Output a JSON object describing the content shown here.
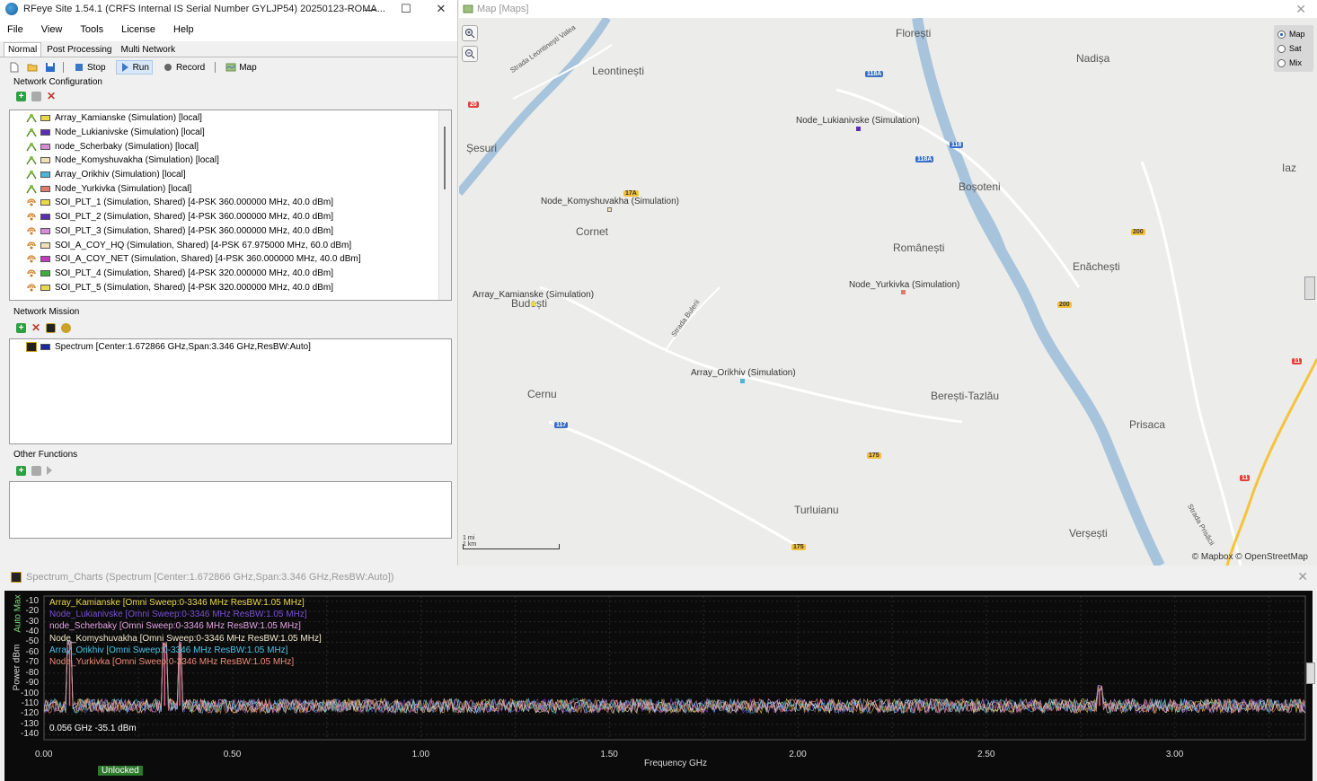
{
  "app": {
    "title": "RFeye Site 1.54.1 (CRFS Internal IS Serial Number GYLJP54) 20250123-ROMA...",
    "window_controls": {
      "minimize": "—",
      "maximize": "☐",
      "close": "✕"
    },
    "menu": [
      "File",
      "View",
      "Tools",
      "License",
      "Help"
    ],
    "tabs": [
      "Normal",
      "Post Processing",
      "Multi Network"
    ],
    "active_tab": "Normal",
    "toolbar": {
      "stop": "Stop",
      "run": "Run",
      "record": "Record",
      "map": "Map"
    }
  },
  "network_configuration": {
    "label": "Network Configuration",
    "items": [
      {
        "label": "Array_Kamianske (Simulation) [local]",
        "color": "#e9d84a",
        "kind": "node"
      },
      {
        "label": "Node_Lukianivske (Simulation) [local]",
        "color": "#5b2fb3",
        "kind": "node"
      },
      {
        "label": "node_Scherbaky (Simulation) [local]",
        "color": "#d48bd8",
        "kind": "node"
      },
      {
        "label": "Node_Komyshuvakha (Simulation) [local]",
        "color": "#f1dfb5",
        "kind": "node"
      },
      {
        "label": "Array_Orikhiv (Simulation) [local]",
        "color": "#4bb4d8",
        "kind": "node"
      },
      {
        "label": "Node_Yurkivka (Simulation) [local]",
        "color": "#e07a6a",
        "kind": "node"
      },
      {
        "label": "SOI_PLT_1 (Simulation, Shared) [4-PSK 360.000000 MHz, 40.0 dBm]",
        "color": "#e9d84a",
        "kind": "soi"
      },
      {
        "label": "SOI_PLT_2 (Simulation, Shared) [4-PSK 360.000000 MHz, 40.0 dBm]",
        "color": "#5b2fb3",
        "kind": "soi"
      },
      {
        "label": "SOI_PLT_3 (Simulation, Shared) [4-PSK 360.000000 MHz, 40.0 dBm]",
        "color": "#d48bd8",
        "kind": "soi"
      },
      {
        "label": "SOI_A_COY_HQ (Simulation, Shared) [4-PSK 67.975000 MHz, 60.0 dBm]",
        "color": "#f1dfb5",
        "kind": "soi"
      },
      {
        "label": "SOI_A_COY_NET (Simulation, Shared) [4-PSK 360.000000 MHz, 40.0 dBm]",
        "color": "#c13cc1",
        "kind": "soi"
      },
      {
        "label": "SOI_PLT_4 (Simulation, Shared) [4-PSK 320.000000 MHz, 40.0 dBm]",
        "color": "#3cae3c",
        "kind": "soi"
      },
      {
        "label": "SOI_PLT_5 (Simulation, Shared) [4-PSK 320.000000 MHz, 40.0 dBm]",
        "color": "#e9d84a",
        "kind": "soi"
      }
    ]
  },
  "network_mission": {
    "label": "Network Mission",
    "items": [
      {
        "label": "Spectrum [Center:1.672866 GHz,Span:3.346 GHz,ResBW:Auto]"
      }
    ]
  },
  "other_functions": {
    "label": "Other Functions"
  },
  "map": {
    "title": "Map [Maps]",
    "close": "✕",
    "modes": [
      "Map",
      "Sat",
      "Mix"
    ],
    "selected_mode": "Map",
    "attribution": "© Mapbox © OpenStreetMap",
    "scale": {
      "mi": "1 mi",
      "km": "1 km"
    },
    "places": [
      {
        "name": "Florești"
      },
      {
        "name": "Nadișa"
      },
      {
        "name": "Leontinești"
      },
      {
        "name": "Șesuri"
      },
      {
        "name": "Boșoteni"
      },
      {
        "name": "Iaz"
      },
      {
        "name": "Cornet"
      },
      {
        "name": "Românești"
      },
      {
        "name": "Enăchești"
      },
      {
        "name": "Budești"
      },
      {
        "name": "Cernu"
      },
      {
        "name": "Berești-Tazlău"
      },
      {
        "name": "Prisaca"
      },
      {
        "name": "Turluianu"
      },
      {
        "name": "Verșești"
      }
    ],
    "streets": [
      "Strada Leontinești Valea",
      "Strada Bulerii",
      "Strada Prisăcii"
    ],
    "roads": [
      "20",
      "118A",
      "118",
      "118A",
      "17A",
      "200",
      "200",
      "117",
      "175",
      "175",
      "11",
      "11"
    ],
    "nodes": [
      {
        "label": "Node_Lukianivske (Simulation)",
        "color": "#5b2fb3"
      },
      {
        "label": "Node_Komyshuvakha (Simulation)",
        "color": "#f1dfb5"
      },
      {
        "label": "Array_Kamianske (Simulation)",
        "color": "#e9d84a"
      },
      {
        "label": "Node_Yurkivka (Simulation)",
        "color": "#e07a6a"
      },
      {
        "label": "Array_Orikhiv (Simulation)",
        "color": "#4bb4d8"
      }
    ]
  },
  "spectrum": {
    "title": "Spectrum_Charts (Spectrum [Center:1.672866 GHz,Span:3.346 GHz,ResBW:Auto])",
    "close": "✕",
    "auto_max": "Auto Max",
    "y_label": "Power dBm",
    "x_label": "Frequency GHz",
    "readout": "0.056 GHz -35.1 dBm",
    "status": "Unlocked",
    "legend": [
      {
        "label": "Array_Kamianske [Omni Sweep:0-3346 MHz ResBW:1.05 MHz]",
        "color": "#e9d84a"
      },
      {
        "label": "Node_Lukianivske [Omni Sweep:0-3346 MHz ResBW:1.05 MHz]",
        "color": "#7a4fd6"
      },
      {
        "label": "node_Scherbaky [Omni Sweep:0-3346 MHz ResBW:1.05 MHz]",
        "color": "#e6a3e6"
      },
      {
        "label": "Node_Komyshuvakha [Omni Sweep:0-3346 MHz ResBW:1.05 MHz]",
        "color": "#f3ead0"
      },
      {
        "label": "Array_Orikhiv [Omni Sweep:0-3346 MHz ResBW:1.05 MHz]",
        "color": "#4bc4e8"
      },
      {
        "label": "Node_Yurkivka [Omni Sweep:0-3346 MHz ResBW:1.05 MHz]",
        "color": "#f08a7a"
      }
    ],
    "y_ticks": [
      "-10",
      "-20",
      "-30",
      "-40",
      "-50",
      "-60",
      "-70",
      "-80",
      "-90",
      "-100",
      "-110",
      "-120",
      "-130",
      "-140"
    ],
    "x_ticks": [
      "0.00",
      "0.50",
      "1.00",
      "1.50",
      "2.00",
      "2.50",
      "3.00"
    ]
  },
  "chart_data": {
    "type": "line",
    "xlabel": "Frequency GHz",
    "ylabel": "Power dBm",
    "xlim": [
      0,
      3.346
    ],
    "ylim": [
      -145,
      -5
    ],
    "grid": true,
    "legend_placement": "top-left",
    "noise_floor_dbm": -112,
    "peaks": [
      {
        "x": 0.068,
        "y": -50
      },
      {
        "x": 0.32,
        "y": -52
      },
      {
        "x": 0.36,
        "y": -52
      },
      {
        "x": 2.8,
        "y": -95
      }
    ]
  }
}
